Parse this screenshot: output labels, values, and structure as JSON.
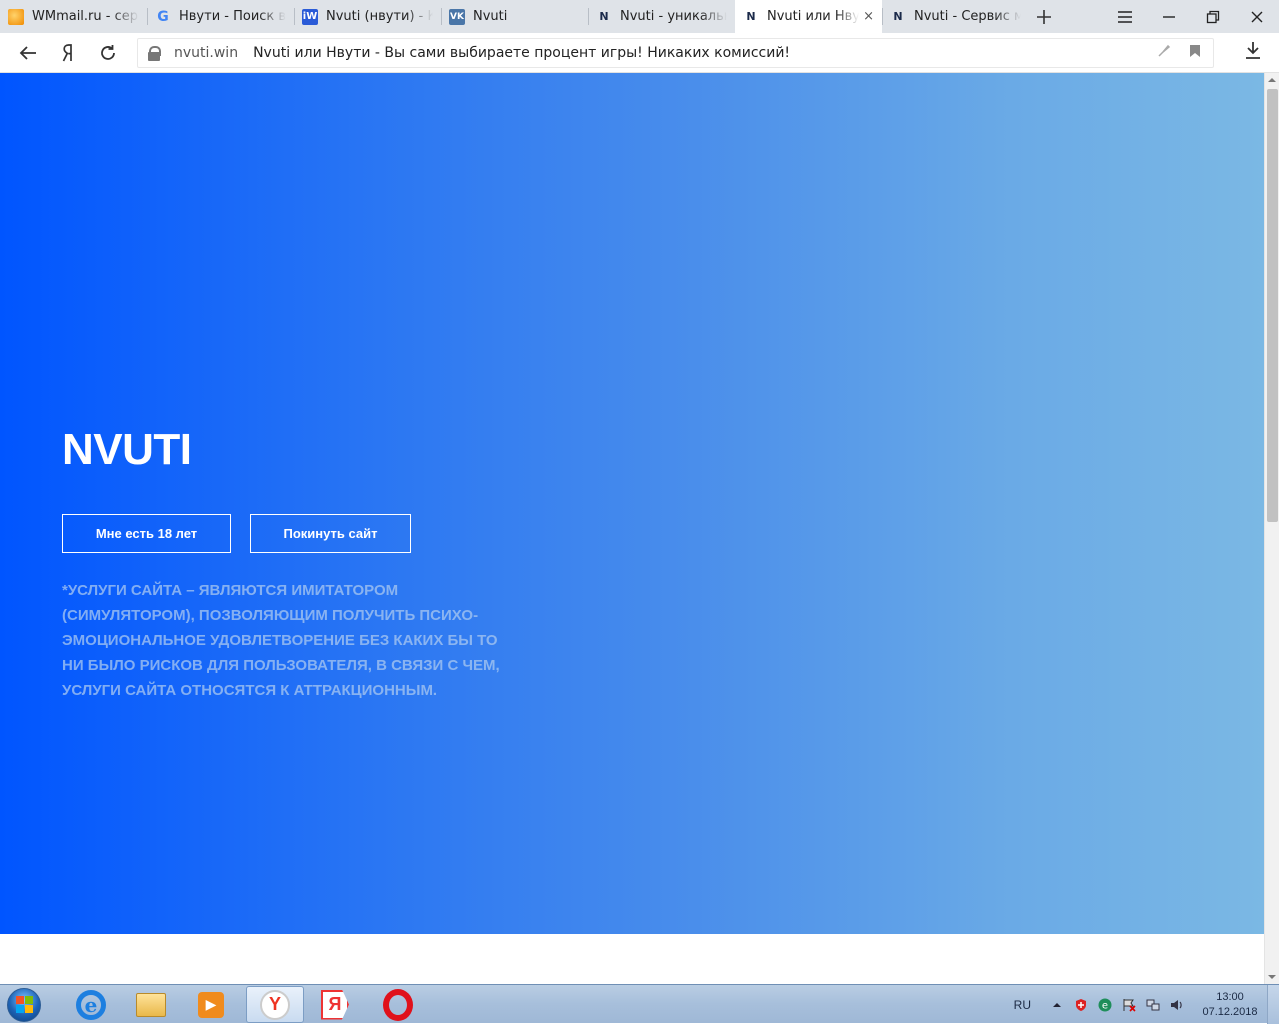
{
  "tabs": [
    {
      "title": "WMmail.ru - серв",
      "favicon": "wmmail-favicon",
      "active": false
    },
    {
      "title": "Нвути - Поиск в G",
      "favicon": "google-favicon",
      "active": false
    },
    {
      "title": "Nvuti (нвути) - Ка",
      "favicon": "iw-favicon",
      "active": false
    },
    {
      "title": "Nvuti",
      "favicon": "vk-favicon",
      "active": false
    },
    {
      "title": "Nvuti - уникальн",
      "favicon": "n-favicon",
      "active": false
    },
    {
      "title": "Nvuti или Нвут",
      "favicon": "n-favicon",
      "active": true
    },
    {
      "title": "Nvuti - Сервис мг",
      "favicon": "n-favicon",
      "active": false
    }
  ],
  "favicon_glyphs": {
    "wm": "",
    "g": "G",
    "iw": "iW",
    "vk": "VK",
    "n": "N"
  },
  "tab_close": "×",
  "address": {
    "domain": "nvuti.win",
    "title": "Nvuti или Нвути - Вы сами выбираете процент игры! Никаких комиссий!"
  },
  "hero": {
    "brand": "NVUTI",
    "age_button": "Мне есть 18 лет",
    "leave_button": "Покинуть сайт",
    "disclaimer": "*Услуги сайта – являются имитатором (симулятором), позволяющим получить психо-эмоциональное удовлетворение без каких бы то ни было рисков для пользователя, в связи с чем, услуги сайта относятся к аттракционным."
  },
  "taskbar": {
    "language": "RU",
    "time": "13:00",
    "date": "07.12.2018"
  },
  "colors": {
    "hero_start": "#0055ff",
    "hero_end": "#7bb8e4",
    "disclaimer": "#aac8f0"
  }
}
